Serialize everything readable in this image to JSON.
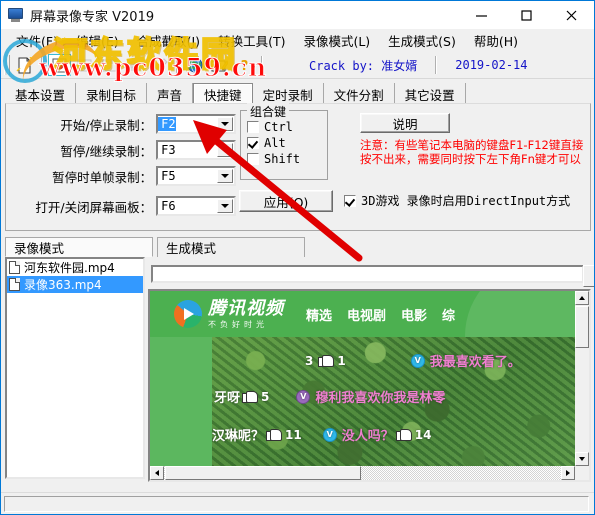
{
  "window": {
    "title": "屏幕录像专家 V2019",
    "icon": "app-icon",
    "minimize": "—",
    "maximize": "□",
    "close": "✕"
  },
  "menu": [
    {
      "label": "文件(F)",
      "name": "menu-file"
    },
    {
      "label": "编辑(E)",
      "name": "menu-edit"
    },
    {
      "label": "合成截取(J)",
      "name": "menu-compose"
    },
    {
      "label": "转换工具(T)",
      "name": "menu-convert"
    },
    {
      "label": "录像模式(L)",
      "name": "menu-record-mode"
    },
    {
      "label": "生成模式(S)",
      "name": "menu-produce-mode"
    },
    {
      "label": "帮助(H)",
      "name": "menu-help"
    }
  ],
  "toolbar": {
    "buttons": [
      {
        "name": "new-file-icon",
        "glyph": "new"
      },
      {
        "name": "record-icon",
        "glyph": "record",
        "active": true
      },
      {
        "name": "stop-icon",
        "glyph": "stop"
      },
      {
        "name": "save-icon",
        "glyph": "save"
      },
      {
        "name": "play-icon",
        "glyph": "play"
      },
      {
        "name": "edit-icon",
        "glyph": "edit"
      },
      {
        "name": "globe-icon",
        "glyph": "globe"
      },
      {
        "name": "register-icon",
        "glyph": "register"
      },
      {
        "name": "help-icon",
        "glyph": "help"
      }
    ],
    "crack_text": "Crack by: 准女婿",
    "date_text": "2019-02-14"
  },
  "tabs": [
    {
      "label": "基本设置",
      "name": "tab-basic-settings",
      "selected": false
    },
    {
      "label": "录制目标",
      "name": "tab-record-target",
      "selected": false
    },
    {
      "label": "声音",
      "name": "tab-sound",
      "selected": false
    },
    {
      "label": "快捷键",
      "name": "tab-hotkeys",
      "selected": true
    },
    {
      "label": "定时录制",
      "name": "tab-timed-record",
      "selected": false
    },
    {
      "label": "文件分割",
      "name": "tab-file-split",
      "selected": false
    },
    {
      "label": "其它设置",
      "name": "tab-other-settings",
      "selected": false
    }
  ],
  "hotkeys": {
    "rows": [
      {
        "label": "开始/停止录制：",
        "value": "F2",
        "selected": true,
        "name": "hotkey-start-stop"
      },
      {
        "label": "暂停/继续录制：",
        "value": "F3",
        "selected": false,
        "name": "hotkey-pause-resume"
      },
      {
        "label": "暂停时单帧录制：",
        "value": "F5",
        "selected": false,
        "name": "hotkey-single-frame"
      },
      {
        "label": "打开/关闭屏幕画板：",
        "value": "F6",
        "selected": false,
        "name": "hotkey-screen-board"
      }
    ]
  },
  "combo_group": {
    "title": "组合键",
    "items": [
      {
        "label": "Ctrl",
        "checked": false,
        "name": "checkbox-ctrl"
      },
      {
        "label": "Alt",
        "checked": true,
        "name": "checkbox-alt"
      },
      {
        "label": "Shift",
        "checked": false,
        "name": "checkbox-shift"
      }
    ]
  },
  "buttons": {
    "help": "说明",
    "apply": "应用(Q)"
  },
  "notice": "注意：有些笔记本电脑的键盘F1-F12键直接按不出来，需要同时按下左下角Fn键才可以",
  "directinput": {
    "label": "3D游戏 录像时启用DirectInput方式",
    "checked": true
  },
  "mode_tabs": [
    {
      "label": "录像模式",
      "name": "modetab-record",
      "selected": true
    },
    {
      "label": "生成模式",
      "name": "modetab-produce",
      "selected": false
    }
  ],
  "file_list": [
    {
      "label": "河东软件园.mp4",
      "selected": false
    },
    {
      "label": "录像363.mp4",
      "selected": true
    }
  ],
  "path_field": {
    "value": "",
    "placeholder": ""
  },
  "preview": {
    "brand_main": "腾讯视频",
    "brand_sub": "不负好时光",
    "nav": [
      "精选",
      "电视剧",
      "电影",
      "综"
    ],
    "danmaku": [
      {
        "pre_count": "3",
        "post_count": "1",
        "text": "我最喜欢看了。",
        "avatar": "blue",
        "pretext": ""
      },
      {
        "pre_count": "",
        "post_count": "5",
        "text": "穆利我喜欢你我是林零",
        "avatar": "purple",
        "pretext": "牙呀"
      },
      {
        "pre_count": "",
        "post_count": "11",
        "text": "没人吗？",
        "avatar": "blue",
        "pretext": "汉琳呢？",
        "tail_count": "14"
      }
    ]
  },
  "watermark": {
    "line1": "河东软件园",
    "line2": "www.pc0359.cn"
  },
  "colors": {
    "accent": "#3399ff",
    "notice": "#ff0000",
    "crack": "#1414c8",
    "video_green": "#4cb050",
    "title_border": "#0078d7"
  }
}
